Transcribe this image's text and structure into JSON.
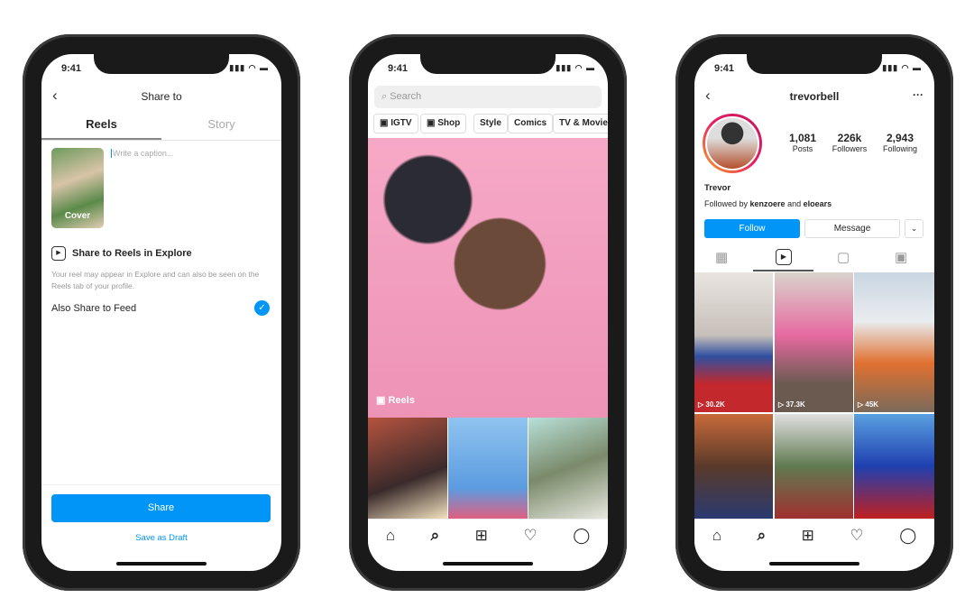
{
  "status": {
    "time": "9:41",
    "icons": "▮▮▮ ◠ ▬"
  },
  "share": {
    "title": "Share to",
    "tabs": [
      "Reels",
      "Story"
    ],
    "cover_label": "Cover",
    "caption_placeholder": "Write a caption...",
    "reels_explore": "Share to Reels in Explore",
    "description": "Your reel may appear in Explore and can also be seen on the Reels tab of your profile.",
    "also_share": "Also Share to Feed",
    "also_share_checked": true,
    "share_button": "Share",
    "draft_button": "Save as Draft",
    "accent": "#0095f6"
  },
  "explore": {
    "search_placeholder": "Search",
    "chips": [
      "IGTV",
      "Shop",
      "Style",
      "Comics",
      "TV & Movie"
    ],
    "reels_label": "Reels"
  },
  "profile": {
    "username": "trevorbell",
    "stats": [
      {
        "value": "1,081",
        "label": "Posts"
      },
      {
        "value": "226k",
        "label": "Followers"
      },
      {
        "value": "2,943",
        "label": "Following"
      }
    ],
    "name": "Trevor",
    "followed_prefix": "Followed by ",
    "followed_a": "kenzoere",
    "followed_mid": " and ",
    "followed_b": "eloears",
    "follow_button": "Follow",
    "message_button": "Message",
    "views": [
      "30.2K",
      "37.3K",
      "45K"
    ]
  },
  "nav_icons": [
    "home-icon",
    "search-icon",
    "add-icon",
    "heart-icon",
    "profile-icon"
  ]
}
